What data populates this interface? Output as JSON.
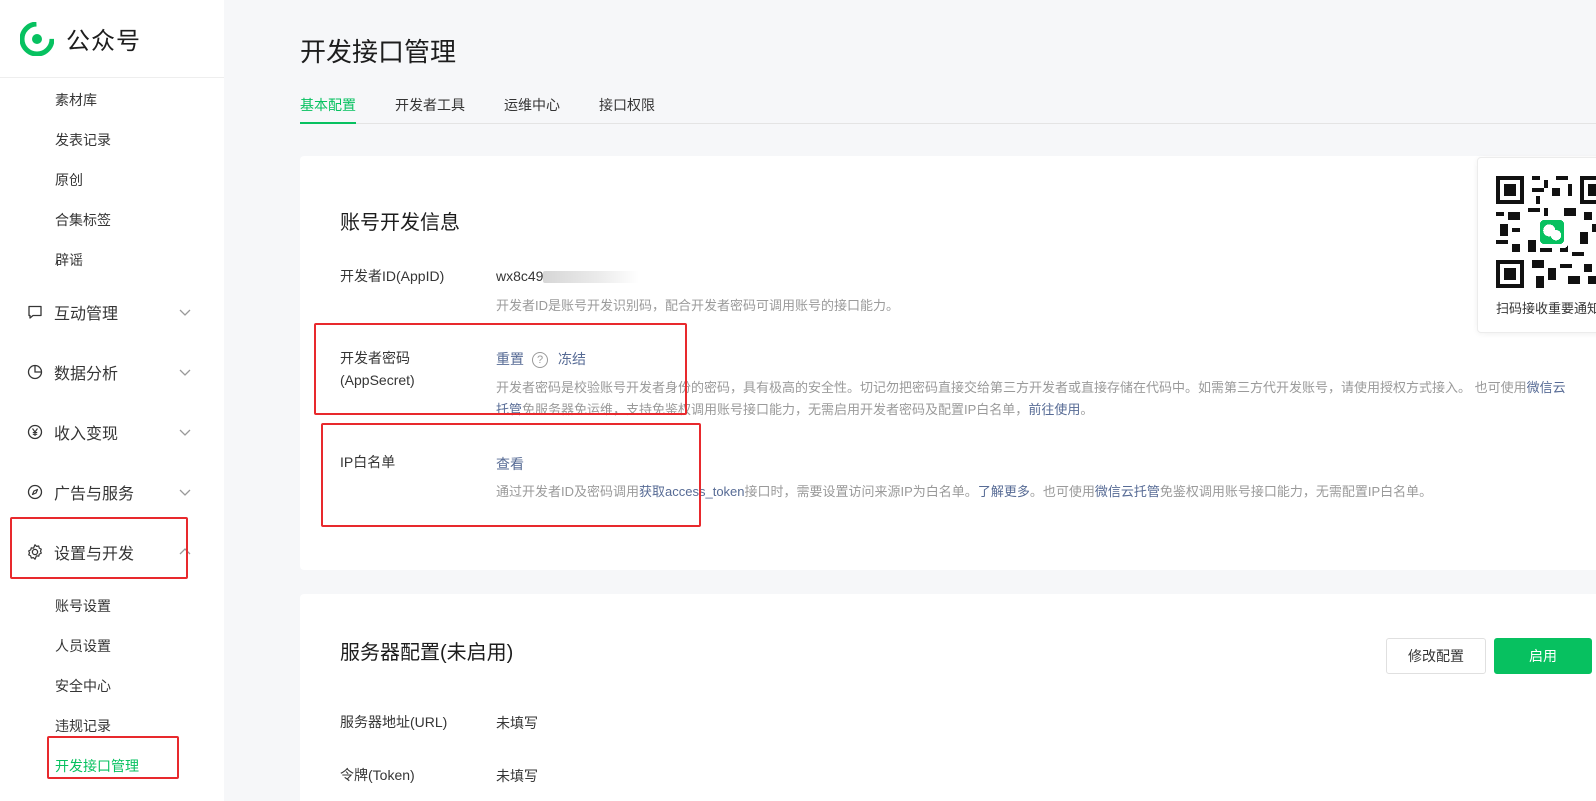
{
  "brand": {
    "name": "公众号"
  },
  "sidebar": {
    "top_items": [
      {
        "label": "素材库"
      },
      {
        "label": "发表记录"
      },
      {
        "label": "原创"
      },
      {
        "label": "合集标签"
      },
      {
        "label": "辟谣"
      }
    ],
    "groups": [
      {
        "label": "互动管理",
        "icon": "message-icon"
      },
      {
        "label": "数据分析",
        "icon": "pie-chart-icon"
      },
      {
        "label": "收入变现",
        "icon": "yen-icon"
      },
      {
        "label": "广告与服务",
        "icon": "compass-icon"
      },
      {
        "label": "设置与开发",
        "icon": "gear-icon"
      }
    ],
    "settings_items": [
      {
        "label": "账号设置"
      },
      {
        "label": "人员设置"
      },
      {
        "label": "安全中心"
      },
      {
        "label": "违规记录"
      },
      {
        "label": "开发接口管理"
      }
    ]
  },
  "page": {
    "title": "开发接口管理",
    "tabs": [
      {
        "label": "基本配置"
      },
      {
        "label": "开发者工具"
      },
      {
        "label": "运维中心"
      },
      {
        "label": "接口权限"
      }
    ]
  },
  "account_dev": {
    "title": "账号开发信息",
    "appid": {
      "label": "开发者ID(AppID)",
      "value_visible": "wx8c49",
      "desc": "开发者ID是账号开发识别码，配合开发者密码可调用账号的接口能力。"
    },
    "appsecret": {
      "label": "开发者密码(AppSecret)",
      "reset": "重置",
      "help": "?",
      "freeze": "冻结",
      "desc_1": "开发者密码是校验账号开发者身份的密码，具有极高的安全性。切记勿把密码直接交给第三方开发者或直接存储在代码中。如需第三方代开发账号，请使用授权方式接入。 也可使用",
      "desc_link_1": "微信云托管",
      "desc_2": "免服务器免运维，支持免鉴权调用账号接口能力，无需启用开发者密码及配置IP白名单，",
      "desc_link_2": "前往使用",
      "desc_end": "。"
    },
    "ip_whitelist": {
      "label": "IP白名单",
      "view": "查看",
      "desc_1": "通过开发者ID及密码调用",
      "desc_link_1": "获取access_token",
      "desc_2": "接口时，需要设置访问来源IP为白名单。",
      "desc_link_2": "了解更多",
      "desc_3": "。也可使用",
      "desc_link_3": "微信云托管",
      "desc_4": "免鉴权调用账号接口能力，无需配置IP白名单。"
    }
  },
  "server_config": {
    "title": "服务器配置(未启用)",
    "modify_button": "修改配置",
    "enable_button": "启用",
    "url": {
      "label": "服务器地址(URL)",
      "value": "未填写"
    },
    "token": {
      "label": "令牌(Token)",
      "value": "未填写"
    }
  },
  "qr": {
    "caption": "扫码接收重要通知"
  },
  "colors": {
    "primary": "#07c160",
    "link": "#576b95",
    "annotation": "#e8292d"
  }
}
